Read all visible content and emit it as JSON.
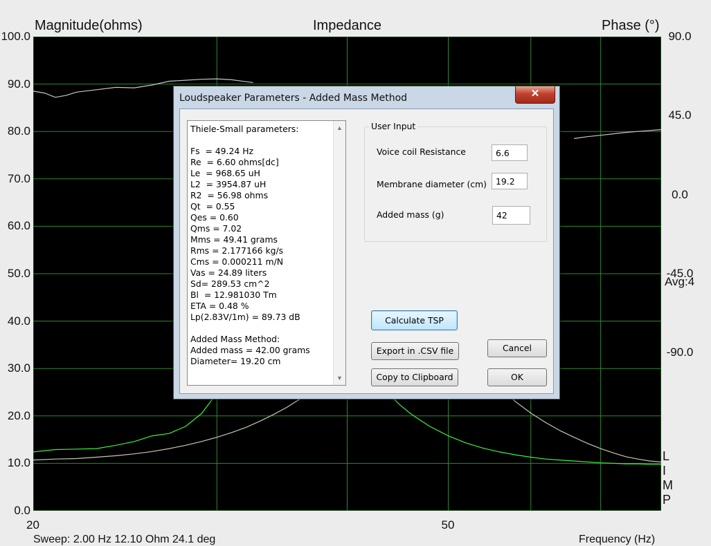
{
  "chart_data": {
    "type": "line",
    "title": "Impedance",
    "ylabel_left": "Magnitude(ohms)",
    "ylabel_right": "Phase (°)",
    "ylim": [
      0,
      100
    ],
    "y2lim": [
      -180,
      90
    ],
    "xlim": [
      20,
      80
    ],
    "x_scale": "log",
    "y_ticks": [
      "100.0",
      "90.0",
      "80.0",
      "70.0",
      "60.0",
      "50.0",
      "40.0",
      "30.0",
      "20.0",
      "10.0",
      "0.0"
    ],
    "y2_ticks": [
      "90.0",
      "45.0",
      "0.0",
      "-45.0",
      "-90.0"
    ],
    "x_ticks": [
      "20",
      "50"
    ],
    "grid": true,
    "background": "#000000",
    "series": [
      {
        "color": "#3cf23c",
        "x": [
          20,
          21,
          22,
          23,
          24,
          25,
          26,
          27,
          28,
          29,
          30,
          31,
          32,
          33,
          34,
          35,
          36,
          37,
          38,
          39,
          40,
          41,
          42,
          43,
          44,
          45,
          46,
          47,
          48,
          50,
          52,
          54,
          56,
          58,
          60,
          62,
          64,
          66,
          68,
          70,
          72,
          74,
          76,
          78,
          80
        ],
        "y": [
          12.4,
          12.9,
          13.0,
          13.1,
          13.8,
          14.6,
          15.8,
          16.3,
          17.8,
          20.5,
          24.8,
          30.5,
          37.8,
          45.0,
          45.2,
          45.0,
          45.0,
          44.8,
          42.5,
          39.5,
          36.5,
          33.0,
          29.8,
          26.8,
          24.3,
          22.2,
          20.5,
          19.1,
          17.8,
          15.8,
          14.3,
          13.2,
          12.4,
          11.8,
          11.3,
          10.9,
          10.7,
          10.5,
          10.3,
          10.1,
          10.0,
          9.9,
          9.9,
          9.8,
          9.8
        ]
      },
      {
        "color": "#c8c8b4",
        "x": [
          20,
          21,
          22,
          23,
          24,
          25,
          26,
          27,
          28,
          29,
          30,
          31,
          32,
          33,
          34,
          35,
          36,
          37,
          38,
          39,
          40,
          41,
          42,
          43,
          44,
          45,
          46,
          47,
          48,
          50,
          52,
          54,
          56,
          58,
          60,
          62,
          64,
          66,
          68,
          70,
          72,
          74,
          76,
          78,
          80
        ],
        "y": [
          10.7,
          10.9,
          11.0,
          11.3,
          11.6,
          12.0,
          12.5,
          13.1,
          13.8,
          14.6,
          15.5,
          16.5,
          17.6,
          18.9,
          20.3,
          21.8,
          23.5,
          25.4,
          27.6,
          30.0,
          33.0,
          36.0,
          39.0,
          42.0,
          44.5,
          45.0,
          45.0,
          45.0,
          44.8,
          40.0,
          34.5,
          29.8,
          26.2,
          23.0,
          20.6,
          18.6,
          16.9,
          15.5,
          14.2,
          13.1,
          12.2,
          11.4,
          10.9,
          10.5,
          10.3
        ]
      },
      {
        "color": "#c8c8c8",
        "x": [
          20,
          20.5,
          21,
          21.5,
          22,
          23,
          24,
          25,
          26,
          27,
          28,
          29,
          30,
          31,
          32,
          32.5
        ],
        "y": [
          88.5,
          88.1,
          87.2,
          87.6,
          88.3,
          88.8,
          89.3,
          89.2,
          89.8,
          90.6,
          90.8,
          91.0,
          91.1,
          90.9,
          90.5,
          90.3
        ]
      },
      {
        "color": "#c8c8c8",
        "x": [
          66,
          68,
          70,
          72,
          74,
          76,
          78,
          80
        ],
        "y": [
          78.5,
          78.9,
          79.2,
          79.5,
          79.8,
          80.0,
          80.2,
          80.4
        ]
      }
    ]
  },
  "labels": {
    "avg": "Avg:4",
    "limp": [
      "L",
      "I",
      "M",
      "P"
    ],
    "status_left": "Sweep: 2.00 Hz 12.10 Ohm 24.1 deg",
    "status_right": "Frequency (Hz)"
  },
  "dialog": {
    "title": "Loudspeaker Parameters - Added Mass Method",
    "close_glyph": "✕",
    "params": [
      "Thiele-Small parameters:",
      "",
      "Fs  = 49.24 Hz",
      "Re  = 6.60 ohms[dc]",
      "Le  = 968.65 uH",
      "L2  = 3954.87 uH",
      "R2  = 56.98 ohms",
      "Qt  = 0.55",
      "Qes = 0.60",
      "Qms = 7.02",
      "Mms = 49.41 grams",
      "Rms = 2.177166 kg/s",
      "Cms = 0.000211 m/N",
      "Vas = 24.89 liters",
      "Sd= 289.53 cm^2",
      "Bl  = 12.981030 Tm",
      "ETA = 0.48 %",
      "Lp(2.83V/1m) = 89.73 dB",
      "",
      "Added Mass Method:",
      "Added mass = 42.00 grams",
      "Diameter= 19.20 cm"
    ],
    "user_input": {
      "title": "User Input",
      "voice_coil_label": "Voice coil Resistance (ohms)",
      "voice_coil_value": "6.6",
      "membrane_label": "Membrane diameter (cm)",
      "membrane_value": "19.2",
      "added_mass_label": "Added mass (g)",
      "added_mass_value": "42"
    },
    "buttons": {
      "calculate": "Calculate TSP",
      "export": "Export in .CSV file",
      "copy": "Copy to Clipboard",
      "cancel": "Cancel",
      "ok": "OK"
    }
  }
}
